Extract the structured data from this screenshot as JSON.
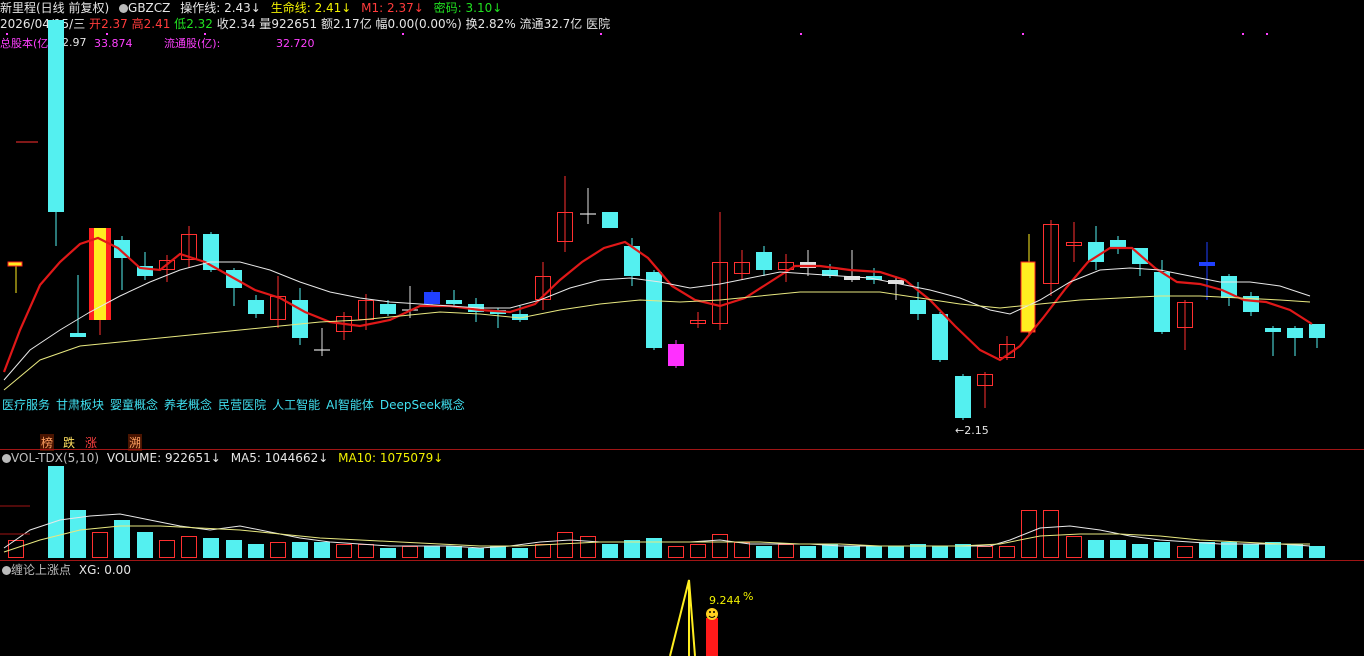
{
  "header": {
    "title": "新里程(日线 前复权)",
    "code": "GBZCZ",
    "items": [
      {
        "label": "操作线:",
        "value": "2.43",
        "arrow": "↓",
        "color": "#ffffff"
      },
      {
        "label": "生命线:",
        "value": "2.41",
        "arrow": "↓",
        "color": "#f0f000"
      },
      {
        "label": "M1:",
        "value": "2.37",
        "arrow": "↓",
        "color": "#ff3b3b"
      },
      {
        "label": "密码:",
        "value": "3.10",
        "arrow": "↓",
        "color": "#20e020"
      }
    ]
  },
  "info": {
    "date": "2026/04/15/三",
    "open_label": "开",
    "open": "2.37",
    "high_label": "高",
    "high": "2.41",
    "low_label": "低",
    "low": "2.32",
    "close_label": "收",
    "close": "2.34",
    "vol_label": "量",
    "vol": "922651",
    "amt_label": "额",
    "amt": "2.17亿",
    "chg_label": "幅",
    "chg": "0.00(0.00%)",
    "turn_label": "换",
    "turn": "2.82%",
    "float_label": "流通",
    "float": "32.7亿",
    "industry": "医院"
  },
  "shares": {
    "total_label": "总股本(亿):",
    "total_price": "2.97",
    "total_value": "33.874",
    "float_label": "流通股(亿):",
    "float_value": "32.720"
  },
  "concepts": [
    "医疗服务",
    "甘肃板块",
    "婴童概念",
    "养老概念",
    "民营医院",
    "人工智能",
    "AI智能体",
    "DeepSeek概念"
  ],
  "tags": [
    {
      "text": "榜",
      "color": "#ffa060",
      "bg": "#5a1a00"
    },
    {
      "text": "跌",
      "color": "#ffe060",
      "bg": "#000"
    },
    {
      "text": "涨",
      "color": "#ff4040",
      "bg": "#000"
    },
    {
      "text": "溯",
      "color": "#ffa060",
      "bg": "#5a1a00"
    }
  ],
  "low_mark": "2.15",
  "volume": {
    "indicator": "VOL-TDX(5,10)",
    "volume_label": "VOLUME:",
    "volume_value": "922651",
    "volume_arrow": "↓",
    "ma5_label": "MA5:",
    "ma5_value": "1044662",
    "ma5_arrow": "↓",
    "ma10_label": "MA10:",
    "ma10_value": "1075079",
    "ma10_arrow": "↓"
  },
  "indicator2": {
    "name": "缠论上涨点",
    "xg_label": "XG:",
    "xg_value": "0.00",
    "pct": "9.244",
    "pct_unit": "%"
  },
  "colors": {
    "up": "#ff3030",
    "down": "#54f0f0",
    "ma_red": "#e01818",
    "ma_white": "#e8e8e8",
    "ma_yellow": "#e8e880",
    "separator": "#a01515"
  }
}
